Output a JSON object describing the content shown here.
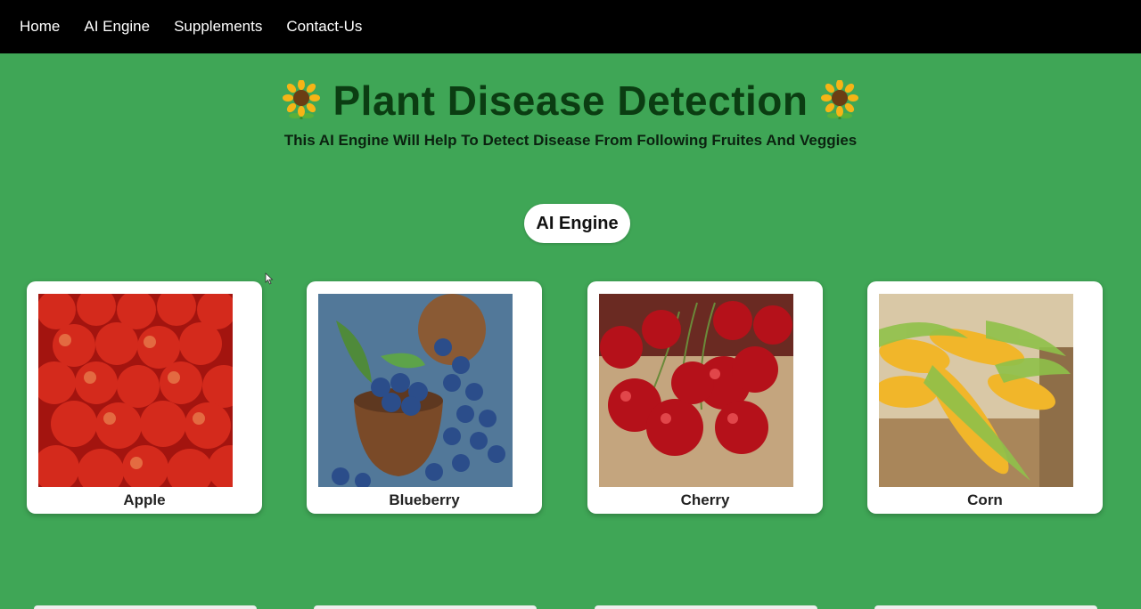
{
  "nav": {
    "items": [
      {
        "label": "Home"
      },
      {
        "label": "AI Engine"
      },
      {
        "label": "Supplements"
      },
      {
        "label": "Contact-Us"
      }
    ]
  },
  "hero": {
    "title": "Plant Disease Detection",
    "subtitle": "This AI Engine Will Help To Detect Disease From Following Fruites And Veggies",
    "icon": "sunflower-icon"
  },
  "engine_button": {
    "label": "AI Engine"
  },
  "cards": [
    {
      "label": "Apple",
      "image": "apple-photo"
    },
    {
      "label": "Blueberry",
      "image": "blueberry-photo"
    },
    {
      "label": "Cherry",
      "image": "cherry-photo"
    },
    {
      "label": "Corn",
      "image": "corn-photo"
    }
  ],
  "colors": {
    "background": "#3fa656",
    "navbar": "#000000",
    "title": "#0b3d12",
    "card": "#ffffff"
  }
}
